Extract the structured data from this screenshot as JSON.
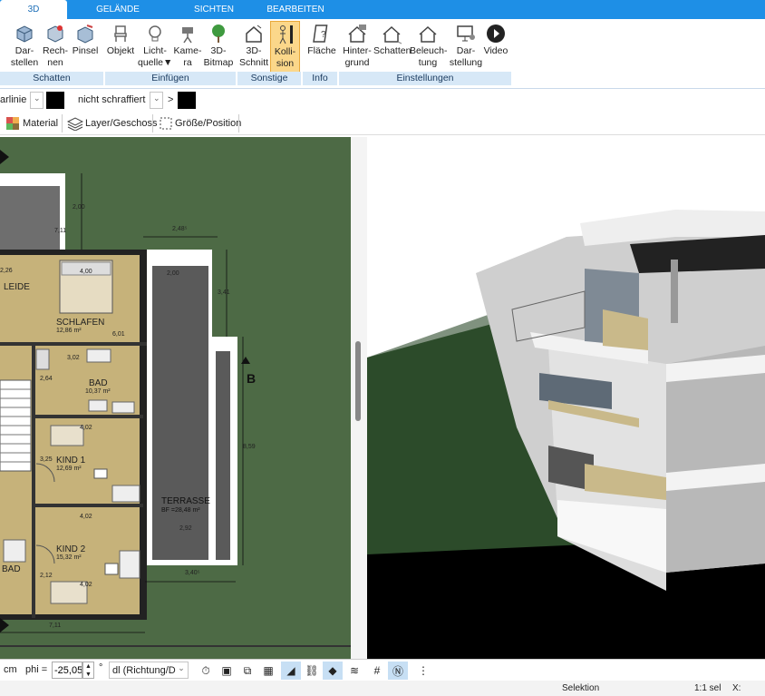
{
  "tabs": [
    "3D",
    "GELÄNDE",
    "SICHTEN",
    "BEARBEITEN"
  ],
  "ribbon": {
    "buttons": [
      {
        "l1": "Dar-",
        "l2": "stellen"
      },
      {
        "l1": "Rech-",
        "l2": "nen"
      },
      {
        "l1": "Pinsel",
        "l2": ""
      },
      {
        "l1": "Objekt",
        "l2": ""
      },
      {
        "l1": "Licht-",
        "l2": "quelle▼"
      },
      {
        "l1": "Kame-",
        "l2": "ra"
      },
      {
        "l1": "3D-",
        "l2": "Bitmap"
      },
      {
        "l1": "3D-",
        "l2": "Schnitt"
      },
      {
        "l1": "Kolli-",
        "l2": "sion"
      },
      {
        "l1": "Fläche",
        "l2": ""
      },
      {
        "l1": "Hinter-",
        "l2": "grund"
      },
      {
        "l1": "Schatten",
        "l2": ""
      },
      {
        "l1": "Beleuch-",
        "l2": "tung"
      },
      {
        "l1": "Dar-",
        "l2": "stellung"
      },
      {
        "l1": "Video",
        "l2": ""
      }
    ],
    "groups": [
      "Schatten",
      "Einfügen",
      "Sonstige",
      "Info",
      "Einstellungen"
    ]
  },
  "props": {
    "line_style": "arlinie",
    "hatch": "nicht schraffiert",
    "arrow": ">"
  },
  "toolbar2": {
    "material": "Material",
    "layer": "Layer/Geschoss",
    "size": "Größe/Position"
  },
  "plan": {
    "rooms": {
      "schlafen": "SCHLAFEN",
      "schlafen_area": "12,86 m²",
      "bad": "BAD",
      "bad_area": "10,37 m²",
      "kind1": "KIND 1",
      "kind1_area": "12,69 m²",
      "kind2": "KIND 2",
      "kind2_area": "15,32 m²",
      "terrasse": "TERRASSE",
      "terrasse_area": "BF =28,48 m²",
      "leide": "LEIDE",
      "bad2": "BAD"
    },
    "dims": [
      "2,48⁵",
      "4,00",
      "3,02",
      "4,02",
      "4,02",
      "4,02",
      "7,11",
      "3,40⁵",
      "2,92",
      "8,59",
      "3,41",
      "2,00",
      "2,64",
      "3,25",
      "6,01",
      "2,26",
      "2,12",
      "7,11",
      "2,00"
    ],
    "section_marker": "B"
  },
  "bottombar": {
    "unit": "cm",
    "phi_label": "phi =",
    "phi_value": "-25,05",
    "degree": "°",
    "dl_value": "dl (Richtung/Di"
  },
  "status": {
    "mode": "Selektion",
    "scale": "1:1 sel",
    "x_label": "X:"
  }
}
